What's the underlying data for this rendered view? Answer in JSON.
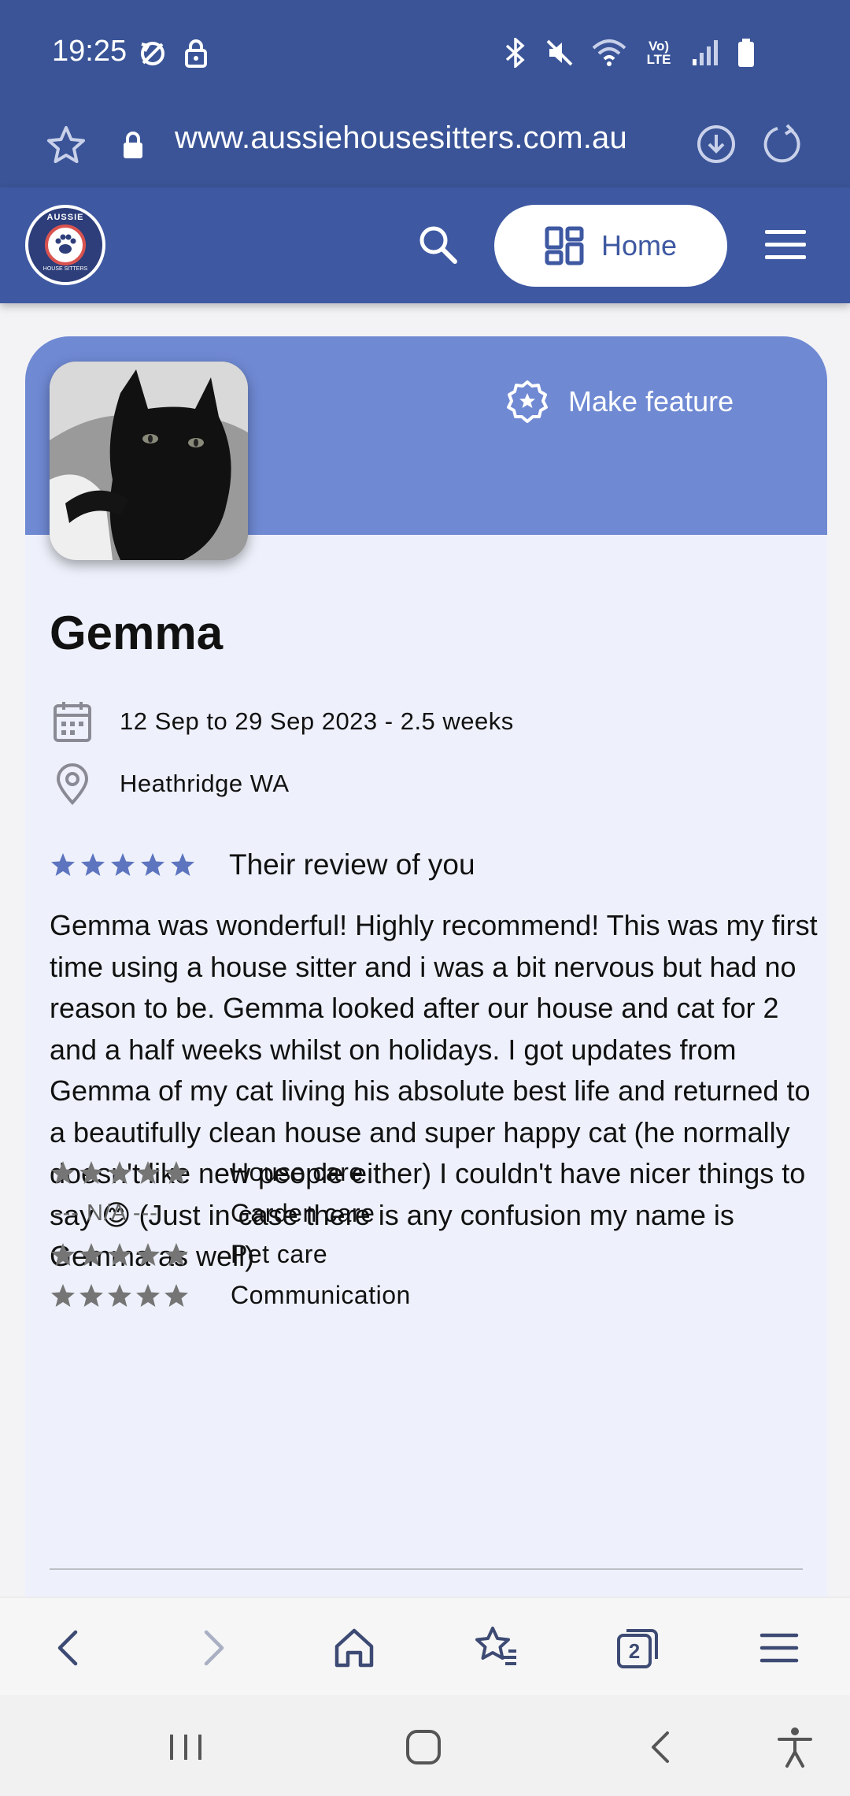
{
  "status_bar": {
    "time": "19:25",
    "icons": [
      "sync-icon",
      "lock-icon",
      "bluetooth-icon",
      "mute-icon",
      "wifi-icon",
      "volte-icon",
      "signal-icon",
      "battery-icon"
    ],
    "volte_label": "Vo) LTE"
  },
  "address_bar": {
    "url": "www.aussiehousesitters.com.au",
    "icons": [
      "bookmark-star-icon",
      "lock-icon",
      "download-icon",
      "reload-icon"
    ]
  },
  "site_header": {
    "logo_text_top": "AUSSIE",
    "logo_text_bottom": "HOUSE SITTERS",
    "home_label": "Home"
  },
  "card": {
    "make_feature_label": "Make feature",
    "name": "Gemma",
    "dates": "12 Sep to 29 Sep 2023 - 2.5 weeks",
    "location": "Heathridge WA",
    "review_rating": 5,
    "review_title": "Their review of you",
    "review_text": "Gemma was wonderful! Highly recommend! This was my first time using a house sitter and i was a bit nervous but had no reason to be. Gemma looked after our house and cat for 2 and a half weeks whilst on holidays. I got updates from Gemma of my cat living his absolute best life and returned to a beautifully clean house and super happy cat (he normally doesn't like new people either) I couldn't have nicer things to say 😊 (Just in case there is any confusion my name is Gemma as well)",
    "ratings": [
      {
        "label": "House care",
        "stars": 5,
        "value": ""
      },
      {
        "label": "Garden care",
        "stars": 0,
        "value": "--- N/A ---"
      },
      {
        "label": "Pet care",
        "stars": 5,
        "value": ""
      },
      {
        "label": "Communication",
        "stars": 5,
        "value": ""
      }
    ]
  },
  "colors": {
    "header_blue": "#3a5497",
    "banner_blue": "#6f89d3",
    "star_blue": "#5d74bf",
    "star_gray": "#757575",
    "card_bg": "#eef1fb"
  },
  "browser_toolbar": {
    "tab_count": "2",
    "icons": [
      "back-icon",
      "forward-icon",
      "home-icon",
      "bookmarks-icon",
      "tabs-icon",
      "menu-icon"
    ]
  },
  "nav_bar": {
    "icons": [
      "recents-icon",
      "home-icon",
      "back-icon",
      "accessibility-icon"
    ]
  }
}
